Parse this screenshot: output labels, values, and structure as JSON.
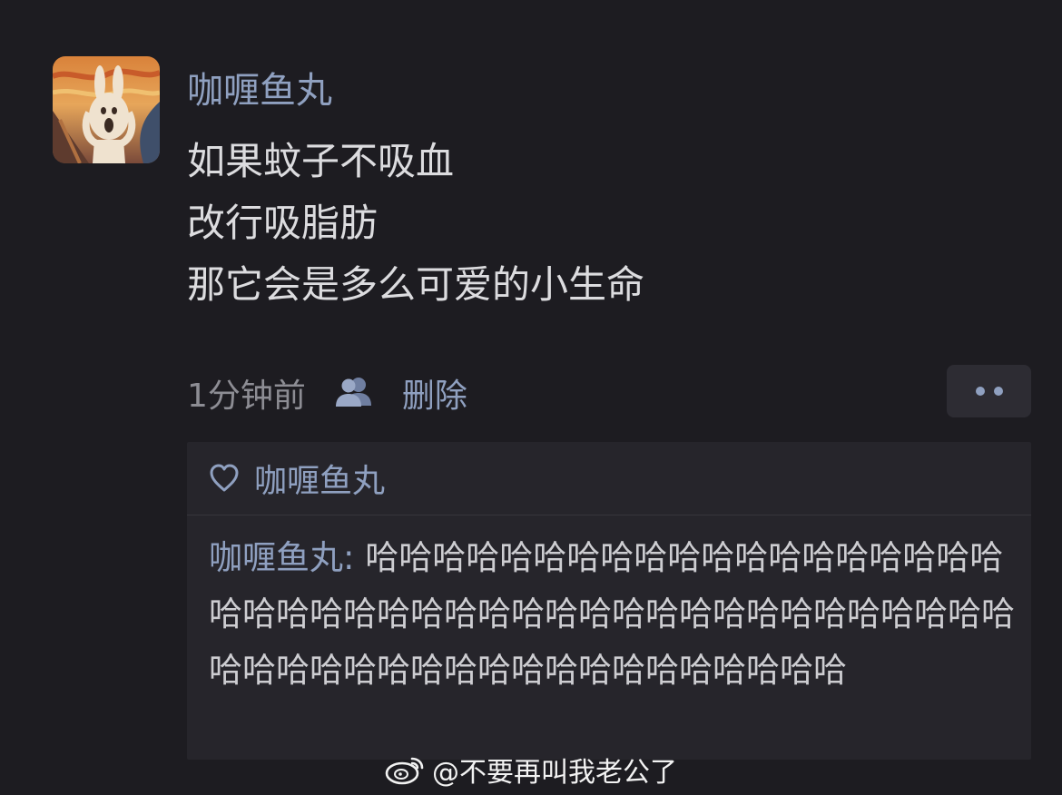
{
  "post": {
    "author": "咖喱鱼丸",
    "lines": [
      "如果蚊子不吸血",
      "改行吸脂肪",
      "那它会是多么可爱的小生命"
    ],
    "timestamp": "1分钟前",
    "visibility_icon": "person-group-icon",
    "delete_label": "删除",
    "more_icon": "more-dots-icon"
  },
  "comments_box": {
    "likes": {
      "icon": "heart-outline-icon",
      "name": "咖喱鱼丸"
    },
    "comment": {
      "author": "咖喱鱼丸",
      "separator": ": ",
      "text": "哈哈哈哈哈哈哈哈哈哈哈哈哈哈哈哈哈哈哈哈哈哈哈哈哈哈哈哈哈哈哈哈哈哈哈哈哈哈哈哈哈哈哈哈哈哈哈哈哈哈哈哈哈哈哈哈哈哈哈哈哈哈"
    }
  },
  "watermark": {
    "icon": "weibo-logo-icon",
    "text": "@不要再叫我老公了"
  },
  "colors": {
    "background": "#1d1c21",
    "name_blue": "#8fa0c0",
    "body_text": "#dcdcdf",
    "meta_gray": "#8d8d94",
    "comment_panel": "#26252b"
  }
}
